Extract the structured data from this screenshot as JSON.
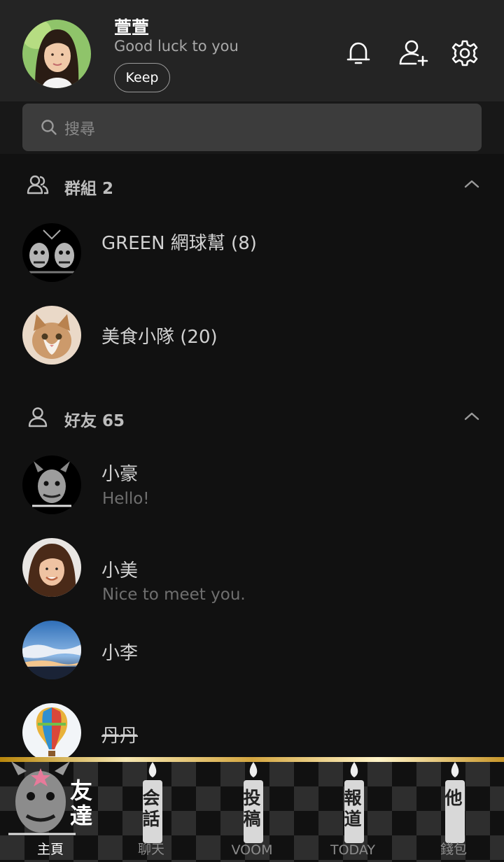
{
  "profile": {
    "name": "萱萱",
    "status": "Good luck to you",
    "keep_label": "Keep"
  },
  "header_icons": [
    "bell-icon",
    "add-friend-icon",
    "settings-icon"
  ],
  "search": {
    "placeholder": "搜尋"
  },
  "groups": {
    "label": "群組 2",
    "items": [
      {
        "name": "GREEN 網球幫 (8)"
      },
      {
        "name": "美食小隊 (20)"
      }
    ]
  },
  "friends": {
    "label": "好友 65",
    "items": [
      {
        "name": "小豪",
        "status": "Hello!"
      },
      {
        "name": "小美",
        "status": "Nice to meet you."
      },
      {
        "name": "小李"
      },
      {
        "name": "丹丹"
      }
    ]
  },
  "tabs": [
    {
      "label": "主頁",
      "glyph": "友達",
      "active": true
    },
    {
      "label": "聊天",
      "glyph": "会話"
    },
    {
      "label": "VOOM",
      "glyph": "投稿"
    },
    {
      "label": "TODAY",
      "glyph": "報道"
    },
    {
      "label": "錢包",
      "glyph": "他"
    }
  ],
  "colors": {
    "background": "#111111",
    "header": "#242424",
    "search_bar": "#3c3c3c",
    "tab_gold": "#d4a640"
  }
}
